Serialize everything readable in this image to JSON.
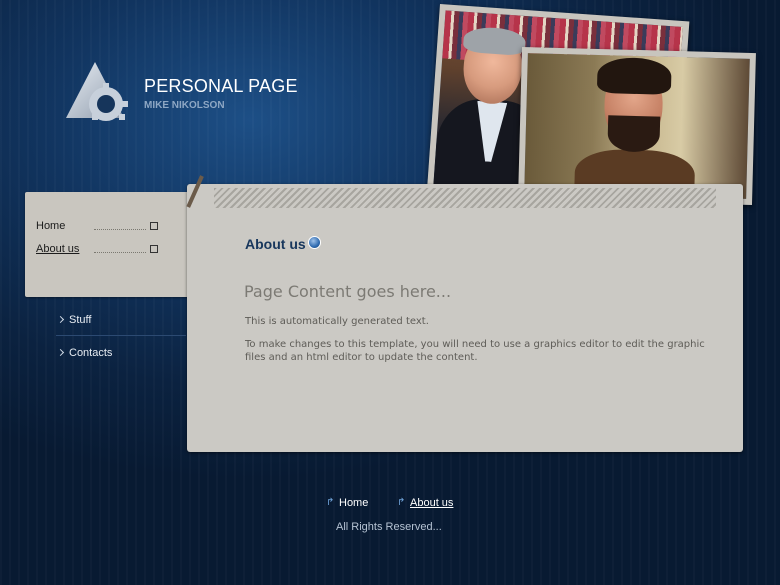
{
  "brand": {
    "title": "PERSONAL PAGE",
    "subtitle": "MIKE NIKOLSON"
  },
  "menu": {
    "items": [
      {
        "label": "Home"
      },
      {
        "label": "About us"
      }
    ]
  },
  "submenu": {
    "items": [
      {
        "label": "Stuff"
      },
      {
        "label": "Contacts"
      }
    ]
  },
  "content": {
    "title": "About us",
    "heading": "Page Content goes here...",
    "paragraphs": [
      "This is automatically generated text.",
      "To make changes to this template, you will need to use a graphics editor to edit the graphic files and an html editor to update the content."
    ]
  },
  "footer": {
    "links": [
      {
        "label": "Home"
      },
      {
        "label": "About us"
      }
    ],
    "copyright": "All Rights Reserved..."
  },
  "icons": {
    "logo": "triangle-gear-logo-icon",
    "menu_marker": "square-marker-icon",
    "submenu_bullet": "chevron-right-icon",
    "title_icon": "blue-orb-icon",
    "footer_arrow": "curved-arrow-icon"
  },
  "colors": {
    "background": "#0b2240",
    "panel": "#cbc9c4",
    "title": "#17365c",
    "link": "#ffffff"
  }
}
